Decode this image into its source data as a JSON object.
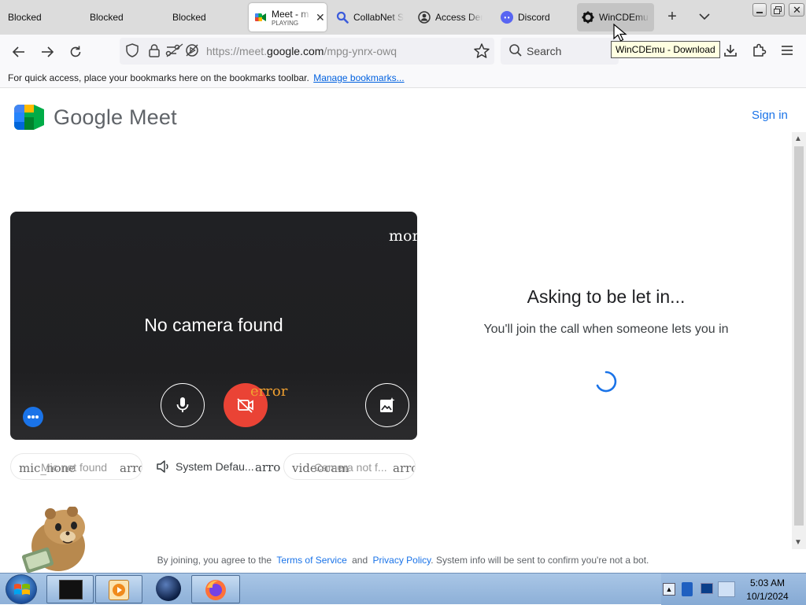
{
  "browser": {
    "tabs": [
      {
        "label": "Blocked"
      },
      {
        "label": "Blocked"
      },
      {
        "label": "Blocked"
      },
      {
        "label": "Meet - m",
        "sublabel": "PLAYING"
      },
      {
        "label": "CollabNet S"
      },
      {
        "label": "Access Den"
      },
      {
        "label": "Discord"
      },
      {
        "label": "WinCDEmu"
      }
    ],
    "url_prefix": "https://meet.",
    "url_domain": "google.com",
    "url_path": "/mpg-ynrx-owq",
    "search_placeholder": "Search",
    "tooltip": "WinCDEmu - Download",
    "bookmarks_text": "For quick access, place your bookmarks here on the bookmarks toolbar.",
    "bookmarks_link": "Manage bookmarks..."
  },
  "meet": {
    "logo_google": "Google",
    "logo_meet": "Meet",
    "sign_in": "Sign in",
    "preview": {
      "no_camera": "No camera found",
      "more_label": "mor",
      "error_label": "error"
    },
    "devices": {
      "mic_icon_text": "mic_none",
      "mic_label": "Mic not found",
      "mic_arrow": "arro",
      "speaker_label": "System Defau...",
      "speaker_arrow": "arro",
      "camera_icon_text": "videocam",
      "camera_label": "Camera not f...",
      "camera_arrow": "arro"
    },
    "status": {
      "title": "Asking to be let in...",
      "subtitle": "You'll join the call when someone lets you in"
    },
    "footer": {
      "prefix": "By joining, you agree to the",
      "terms": "Terms of Service",
      "and": "and",
      "privacy": "Privacy Policy",
      "suffix": ". System info will be sent to confirm you're not a bot."
    }
  },
  "taskbar": {
    "time": "5:03 AM",
    "date": "10/1/2024"
  },
  "colors": {
    "google_blue": "#1a73e8",
    "red_camera": "#ea4335",
    "link_blue": "#1a73e8",
    "error_orange": "#f0a030"
  }
}
